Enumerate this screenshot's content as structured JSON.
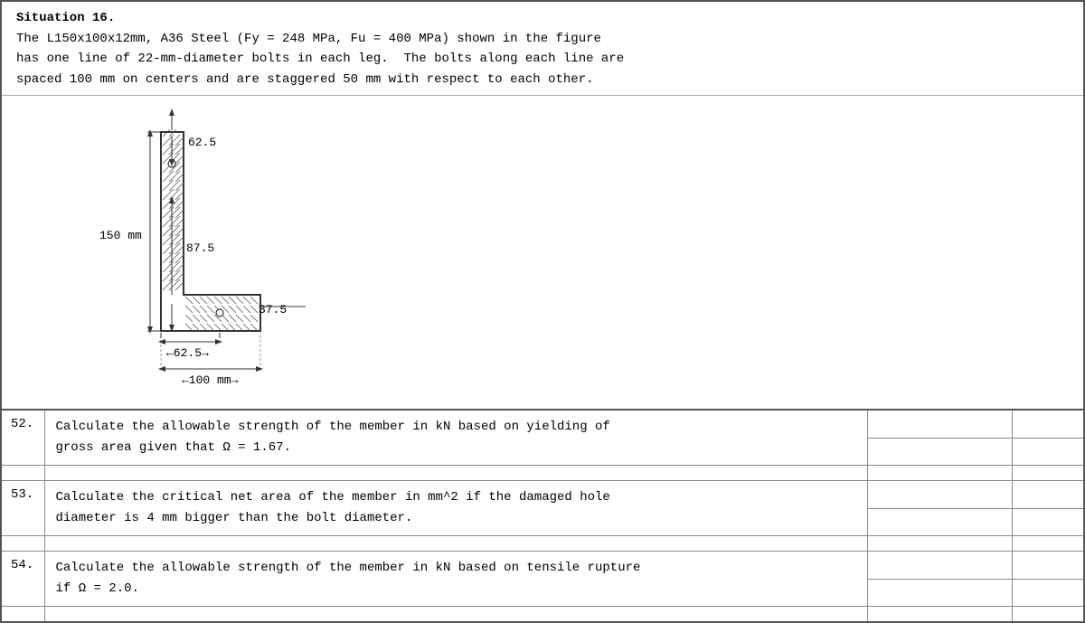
{
  "situation": {
    "title": "Situation 16.",
    "line1": "The L150x100x12mm, A36 Steel (Fy = 248 MPa, Fu = 400 MPa) shown in the figure",
    "line2": "has one line of 22-mm-diameter bolts in each leg.  The bolts along each line are",
    "line3": "spaced 100 mm on centers and are staggered 50 mm with respect to each other."
  },
  "figure": {
    "dim_62_5_top": "62.5",
    "dim_150": "150 mm",
    "dim_87_5": "87.5",
    "dim_62_5_bot": "62.5",
    "dim_37_5": "37.5",
    "dim_100": "100 mm"
  },
  "questions": [
    {
      "number": "52.",
      "text": "Calculate the allowable strength of the member in kN based on yielding of\ngross area given that Ω = 1.67."
    },
    {
      "number": "53.",
      "text": "Calculate the critical net area of the member in mm^2 if the damaged hole\ndiameter is 4 mm bigger than the bolt diameter."
    },
    {
      "number": "54.",
      "text": "Calculate the allowable strength of the member in kN based on tensile rupture\nif Ω = 2.0."
    }
  ]
}
